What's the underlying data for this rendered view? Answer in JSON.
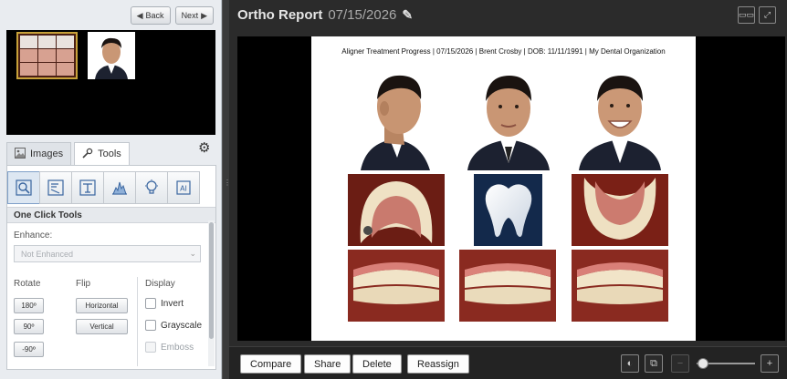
{
  "nav": {
    "back_label": "Back",
    "next_label": "Next"
  },
  "tabs": [
    {
      "label": "Images",
      "icon": "image-icon",
      "active": false
    },
    {
      "label": "Tools",
      "icon": "wrench-icon",
      "active": true
    }
  ],
  "tools": {
    "icons": [
      "zoom-region-icon",
      "annotate-icon",
      "text-tool-icon",
      "histogram-icon",
      "light-bulb-icon",
      "ai-icon"
    ],
    "section_title": "One Click Tools",
    "enhance_label": "Enhance:",
    "enhance_value": "Not Enhanced",
    "rotate_label": "Rotate",
    "rotate_buttons": [
      "180º",
      "90º",
      "-90º"
    ],
    "flip_label": "Flip",
    "flip_buttons": [
      "Horizontal",
      "Vertical"
    ],
    "display_label": "Display",
    "display_options": [
      {
        "label": "Invert",
        "checked": false,
        "enabled": true
      },
      {
        "label": "Grayscale",
        "checked": false,
        "enabled": true
      },
      {
        "label": "Emboss",
        "checked": false,
        "enabled": false
      }
    ]
  },
  "report": {
    "title": "Ortho Report",
    "date": "07/15/2026",
    "header_line": "Aligner Treatment Progress | 07/15/2026 | Brent Crosby | DOB: 11/11/1991 | My Dental Organization"
  },
  "bottom_bar": {
    "buttons": [
      "Compare",
      "Share",
      "Delete",
      "Reassign"
    ],
    "zoom_out_label": "−",
    "zoom_in_label": "+",
    "zoom_level": 0.05
  },
  "colors": {
    "accent_selected": "#c8a23a",
    "dark_background": "#2b2b2b",
    "logo_tile": "#13294b"
  }
}
